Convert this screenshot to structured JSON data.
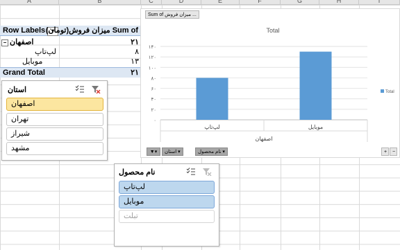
{
  "columns": [
    "A",
    "B",
    "C",
    "D",
    "E",
    "F",
    "G",
    "H",
    "I"
  ],
  "pivot": {
    "header_label": "Row Labels",
    "header_value": "Sum of میزان فروش(تومان)",
    "group_label": "اصفهان",
    "group_value": "۲۱",
    "rows": [
      {
        "label": "لپ‌تاپ",
        "value": "۸"
      },
      {
        "label": "موبایل",
        "value": "۱۳"
      }
    ],
    "total_label": "Grand Total",
    "total_value": "۲۱"
  },
  "slicer_province": {
    "title": "استان",
    "items": [
      {
        "label": "اصفهان",
        "selected": true
      },
      {
        "label": "تهران",
        "selected": false
      },
      {
        "label": "شیراز",
        "selected": false
      },
      {
        "label": "مشهد",
        "selected": false
      }
    ]
  },
  "slicer_product": {
    "title": "نام محصول",
    "items": [
      {
        "label": "لپ‌تاپ",
        "selected": true
      },
      {
        "label": "موبایل",
        "selected": true
      },
      {
        "label": "تبلت",
        "selected": false
      }
    ]
  },
  "chart": {
    "value_button": "Sum of میزان فروش ...",
    "axis_button_1": "نام محصول",
    "axis_button_2": "استان",
    "plus": "+",
    "minus": "−"
  },
  "chart_data": {
    "type": "bar",
    "title": "Total",
    "categories": [
      "لپ‌تاپ",
      "موبایل"
    ],
    "group_label": "اصفهان",
    "series": [
      {
        "name": "Total",
        "values": [
          8,
          13
        ],
        "color": "#5b9bd5"
      }
    ],
    "yticks": [
      "۰",
      "۲۰",
      "۴۰",
      "۶۰",
      "۸۰",
      "۱۰۰",
      "۱۲۰",
      "۱۴۰"
    ],
    "ylim": [
      0,
      14
    ],
    "legend": "right",
    "grid": true
  }
}
